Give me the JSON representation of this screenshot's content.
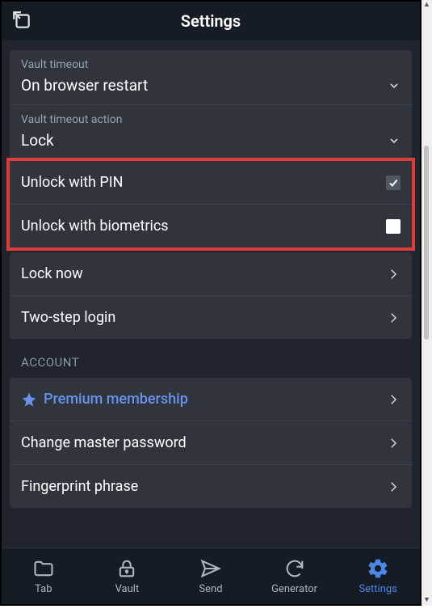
{
  "header": {
    "title": "Settings"
  },
  "security": {
    "vault_timeout_label": "Vault timeout",
    "vault_timeout_value": "On browser restart",
    "vault_timeout_action_label": "Vault timeout action",
    "vault_timeout_action_value": "Lock",
    "unlock_pin_label": "Unlock with PIN",
    "unlock_pin_checked": true,
    "unlock_bio_label": "Unlock with biometrics",
    "unlock_bio_checked": false,
    "lock_now_label": "Lock now",
    "two_step_label": "Two-step login"
  },
  "account": {
    "header": "ACCOUNT",
    "premium_label": "Premium membership",
    "change_master_label": "Change master password",
    "fingerprint_label": "Fingerprint phrase"
  },
  "tabs": {
    "tab": "Tab",
    "vault": "Vault",
    "send": "Send",
    "generator": "Generator",
    "settings": "Settings"
  }
}
